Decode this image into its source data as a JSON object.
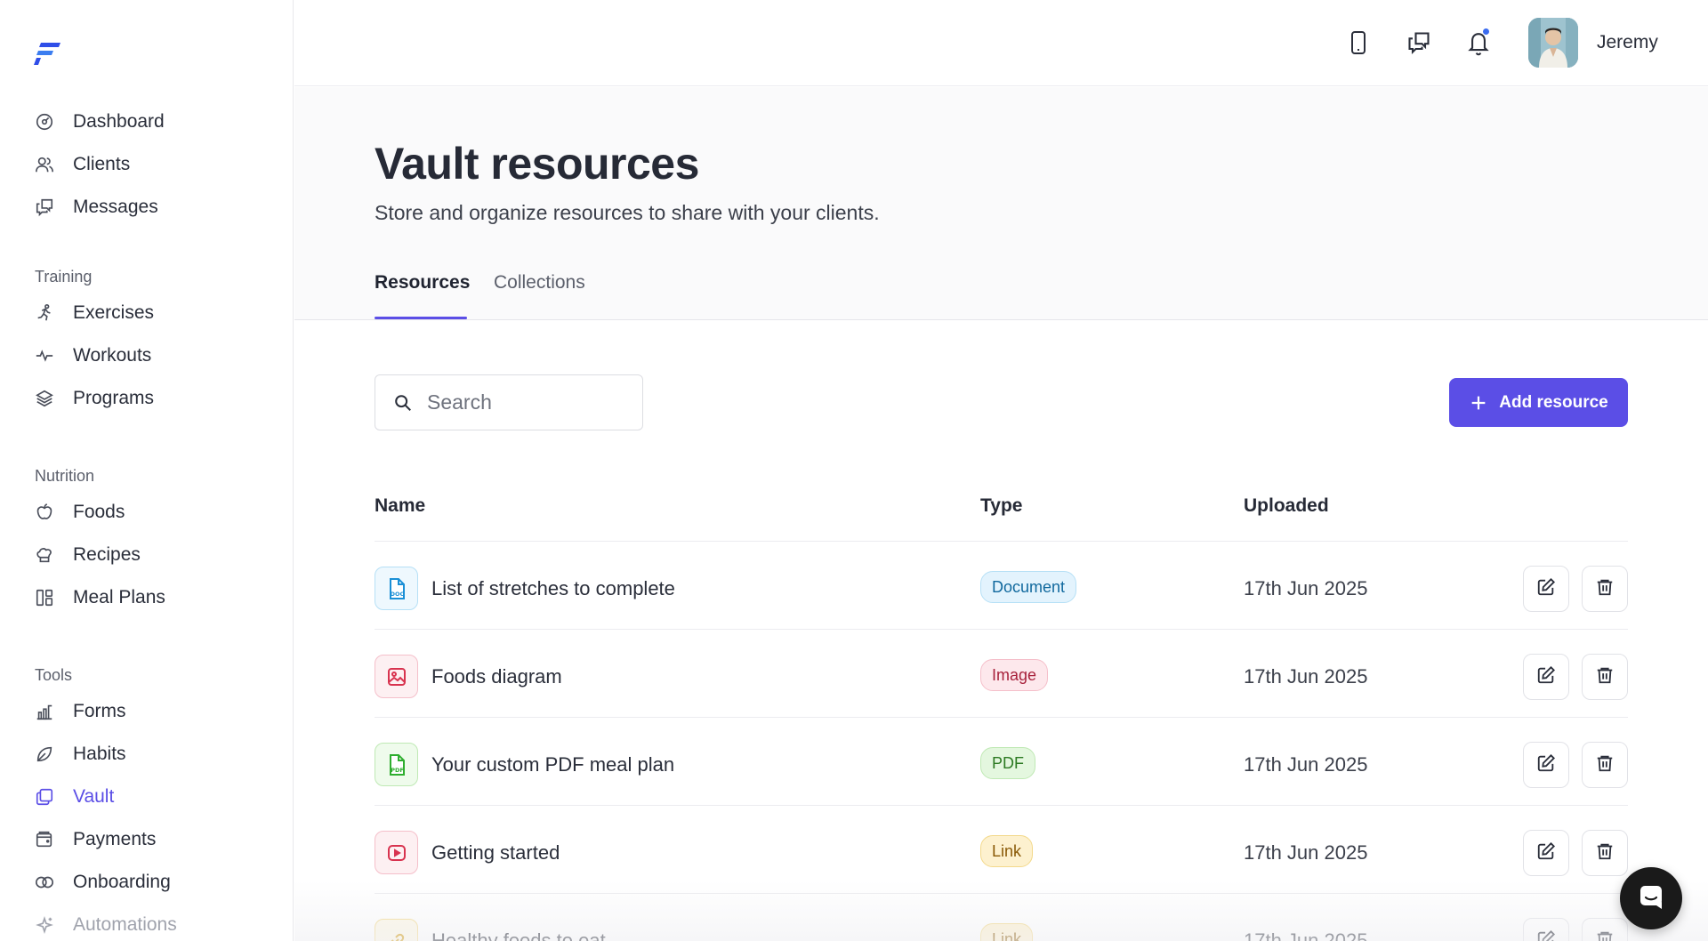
{
  "app": {
    "logo": "F"
  },
  "sidebar": {
    "main": [
      {
        "label": "Dashboard",
        "icon": "dashboard-icon"
      },
      {
        "label": "Clients",
        "icon": "users-icon"
      },
      {
        "label": "Messages",
        "icon": "messages-icon"
      }
    ],
    "training_heading": "Training",
    "training": [
      {
        "label": "Exercises",
        "icon": "running-icon"
      },
      {
        "label": "Workouts",
        "icon": "pulse-icon"
      },
      {
        "label": "Programs",
        "icon": "layers-icon"
      }
    ],
    "nutrition_heading": "Nutrition",
    "nutrition": [
      {
        "label": "Foods",
        "icon": "apple-icon"
      },
      {
        "label": "Recipes",
        "icon": "chef-hat-icon"
      },
      {
        "label": "Meal Plans",
        "icon": "meal-plan-icon"
      }
    ],
    "tools_heading": "Tools",
    "tools": [
      {
        "label": "Forms",
        "icon": "forms-icon"
      },
      {
        "label": "Habits",
        "icon": "leaf-icon"
      },
      {
        "label": "Vault",
        "icon": "vault-icon",
        "active": true
      },
      {
        "label": "Payments",
        "icon": "wallet-icon"
      },
      {
        "label": "Onboarding",
        "icon": "link-icon"
      },
      {
        "label": "Automations",
        "icon": "sparkle-icon"
      }
    ]
  },
  "topbar": {
    "icons": [
      "phone-icon",
      "messages-icon",
      "bell-icon"
    ],
    "user_name": "Jeremy"
  },
  "page": {
    "title": "Vault resources",
    "subtitle": "Store and organize resources to share with your clients.",
    "tabs": [
      {
        "label": "Resources",
        "active": true
      },
      {
        "label": "Collections",
        "active": false
      }
    ]
  },
  "search": {
    "placeholder": "Search",
    "value": ""
  },
  "add_button_label": "Add resource",
  "table": {
    "headers": {
      "name": "Name",
      "type": "Type",
      "uploaded": "Uploaded"
    },
    "rows": [
      {
        "name": "List of stretches to complete",
        "type": "Document",
        "uploaded": "17th Jun 2025",
        "file_icon": "doc-icon"
      },
      {
        "name": "Foods diagram",
        "type": "Image",
        "uploaded": "17th Jun 2025",
        "file_icon": "image-icon"
      },
      {
        "name": "Your custom PDF meal plan",
        "type": "PDF",
        "uploaded": "17th Jun 2025",
        "file_icon": "pdf-icon"
      },
      {
        "name": "Getting started",
        "type": "Link",
        "uploaded": "17th Jun 2025",
        "file_icon": "video-icon"
      },
      {
        "name": "Healthy foods to eat",
        "type": "Link",
        "uploaded": "17th Jun 2025",
        "file_icon": "link-icon"
      }
    ]
  },
  "colors": {
    "accent": "#5b4ee6",
    "document_badge": "#e3f3fd",
    "image_badge": "#fde8ec",
    "pdf_badge": "#e4f7df",
    "link_badge": "#fdf1cf"
  }
}
